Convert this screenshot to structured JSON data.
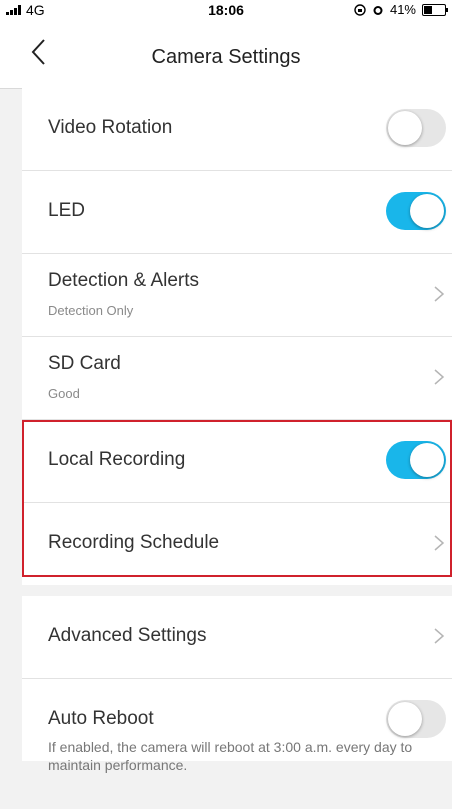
{
  "status_bar": {
    "network": "4G",
    "time": "18:06",
    "battery_text": "41%",
    "battery_level": 0.41
  },
  "nav": {
    "title": "Camera Settings"
  },
  "rows": {
    "video_rotation": {
      "label": "Video Rotation",
      "enabled": false
    },
    "led": {
      "label": "LED",
      "enabled": true
    },
    "detection_alerts": {
      "label": "Detection & Alerts",
      "sub": "Detection Only"
    },
    "sd_card": {
      "label": "SD Card",
      "sub": "Good"
    },
    "local_recording": {
      "label": "Local Recording",
      "enabled": true
    },
    "recording_schedule": {
      "label": "Recording Schedule"
    },
    "advanced_settings": {
      "label": "Advanced Settings"
    },
    "auto_reboot": {
      "label": "Auto Reboot",
      "enabled": false
    }
  },
  "footer": {
    "note": "If enabled, the camera will reboot at 3:00 a.m. every day to maintain performance."
  },
  "colors": {
    "accent": "#19b6ea",
    "highlight": "#d0212c"
  }
}
